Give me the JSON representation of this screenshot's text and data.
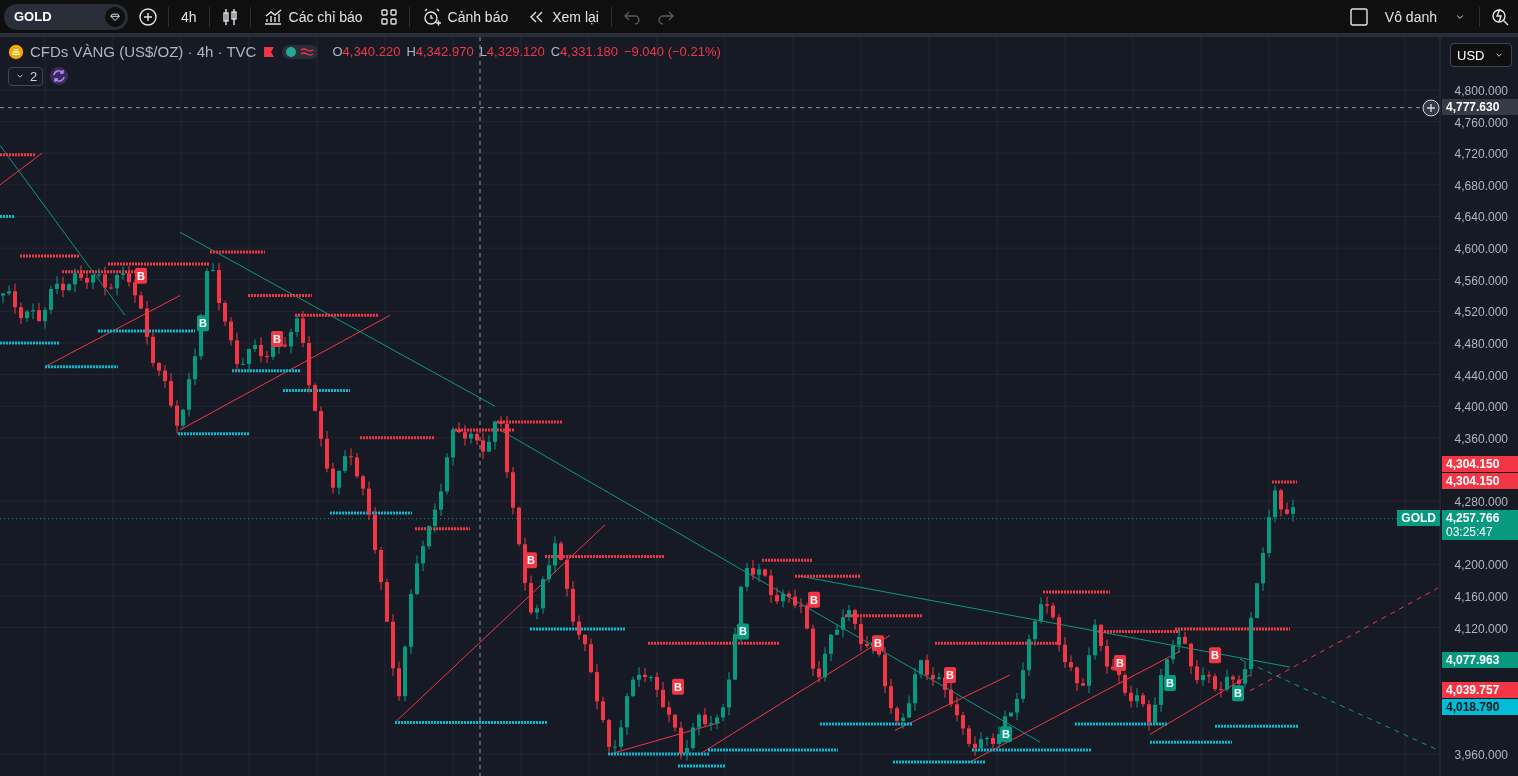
{
  "toolbar": {
    "symbol": "GOLD",
    "interval": "4h",
    "buttons": [
      {
        "kind": "indicators",
        "label": "Các chỉ báo"
      },
      {
        "kind": "alert",
        "label": "Cảnh báo"
      },
      {
        "kind": "replay",
        "label": "Xem lại"
      }
    ],
    "undo_disabled": true,
    "redo_disabled": true,
    "layout_name": "Vô danh"
  },
  "legend": {
    "title": "CFDs VÀNG (US$/OZ) · 4h · TVC",
    "ohlc": [
      {
        "key": "O",
        "value": "4,340.220"
      },
      {
        "key": "H",
        "value": "4,342.970"
      },
      {
        "key": "L",
        "value": "4,329.120"
      },
      {
        "key": "C",
        "value": "4,331.180"
      }
    ],
    "change": "−9.040 (−0.21%)",
    "collapsed_count": "2"
  },
  "price_axis": {
    "currency": "USD",
    "ticks": [
      "4,800.000",
      "4,760.000",
      "4,720.000",
      "4,680.000",
      "4,640.000",
      "4,600.000",
      "4,560.000",
      "4,520.000",
      "4,480.000",
      "4,440.000",
      "4,400.000",
      "4,360.000",
      "4,280.000",
      "4,200.000",
      "4,160.000",
      "4,120.000",
      "3,960.000"
    ],
    "labels": [
      {
        "kind": "crosshair",
        "value": "4,777.630"
      },
      {
        "kind": "level_red",
        "value": "4,304.150"
      },
      {
        "kind": "level_red",
        "value": "4,304.150"
      },
      {
        "kind": "last_price",
        "symbol": "GOLD",
        "value": "4,257.766",
        "countdown": "03:25:47"
      },
      {
        "kind": "level_green",
        "value": "4,077.963"
      },
      {
        "kind": "level_red",
        "value": "4,039.757"
      },
      {
        "kind": "level_cyan",
        "value": "4,018.790"
      }
    ]
  },
  "signals": [
    {
      "label": "B",
      "kind": "sell"
    },
    {
      "label": "B",
      "kind": "buy"
    },
    {
      "label": "B",
      "kind": "sell"
    },
    {
      "label": "B",
      "kind": "sell"
    },
    {
      "label": "B",
      "kind": "sell"
    },
    {
      "label": "B",
      "kind": "buy"
    },
    {
      "label": "B",
      "kind": "sell"
    },
    {
      "label": "B",
      "kind": "sell"
    },
    {
      "label": "B",
      "kind": "sell"
    },
    {
      "label": "B",
      "kind": "buy"
    },
    {
      "label": "B",
      "kind": "sell"
    },
    {
      "label": "B",
      "kind": "buy"
    },
    {
      "label": "B",
      "kind": "sell"
    },
    {
      "label": "B",
      "kind": "buy"
    }
  ]
}
